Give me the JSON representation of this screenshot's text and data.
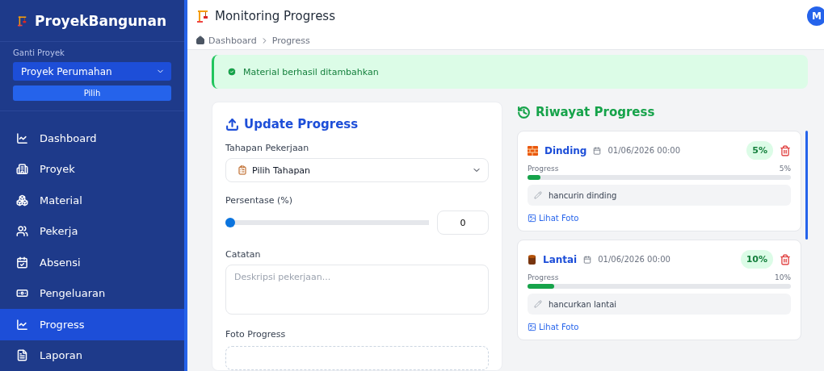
{
  "sidebar": {
    "brand": "ProyekBangunan",
    "project_label": "Ganti Proyek",
    "project_select": "Proyek Perumahan",
    "choose_button": "Pilih",
    "items": [
      {
        "label": "Dashboard",
        "selected": false
      },
      {
        "label": "Proyek",
        "selected": false
      },
      {
        "label": "Material",
        "selected": false
      },
      {
        "label": "Pekerja",
        "selected": false
      },
      {
        "label": "Absensi",
        "selected": false
      },
      {
        "label": "Pengeluaran",
        "selected": false
      },
      {
        "label": "Progress",
        "selected": true
      },
      {
        "label": "Laporan",
        "selected": false
      }
    ]
  },
  "header": {
    "title": "Monitoring Progress",
    "avatar": "M"
  },
  "breadcrumb": [
    "Dashboard",
    "Progress"
  ],
  "alert": "Material berhasil ditambahkan",
  "form": {
    "title": "Update Progress",
    "stage_label": "Tahapan Pekerjaan",
    "stage_value": "Pilih Tahapan",
    "percent_label": "Persentase (%)",
    "level": 0,
    "percent_value": "0",
    "notes_label": "Catatan",
    "notes_placeholder": "Deskripsi pekerjaan...",
    "photo_label": "Foto Progress"
  },
  "history": {
    "title": "Riwayat Progress",
    "entries": [
      {
        "kind": "brick",
        "name": "Dinding",
        "date": "01/06/2026 00:00",
        "badge": "5%",
        "progress_label": "Progress",
        "progress_value": "5%",
        "level": 0.05,
        "note": "hancurin dinding",
        "link": "Lihat Foto"
      },
      {
        "kind": "wood",
        "name": "Lantai",
        "date": "01/06/2026 00:00",
        "badge": "10%",
        "progress_label": "Progress",
        "progress_value": "10%",
        "level": 0.1,
        "note": "hancurkan lantai",
        "link": "Lihat Foto"
      }
    ]
  }
}
